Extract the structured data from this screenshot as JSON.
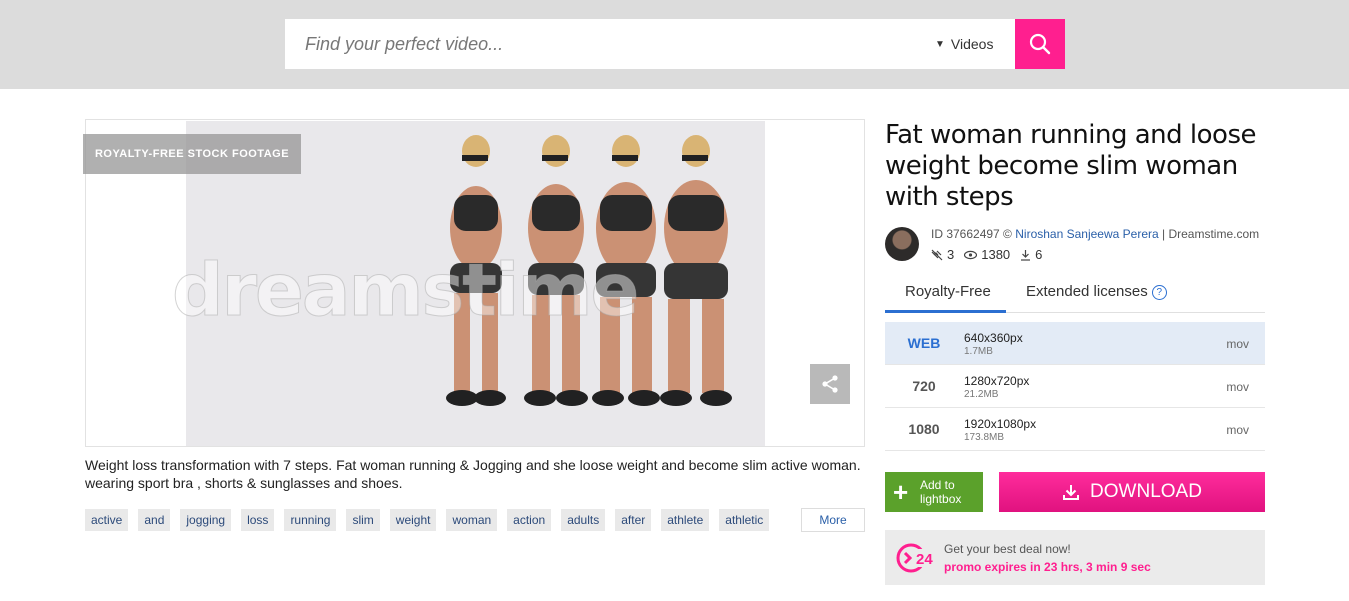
{
  "search": {
    "placeholder": "Find your perfect video...",
    "type_label": "Videos"
  },
  "media": {
    "badge": "ROYALTY-FREE STOCK FOOTAGE",
    "watermark": "dreamstime"
  },
  "description": "Weight loss transformation with 7 steps. Fat woman running & Jogging and she loose weight and become slim active woman. wearing sport bra , shorts & sunglasses and shoes.",
  "tags": [
    "active",
    "and",
    "jogging",
    "loss",
    "running",
    "slim",
    "weight",
    "woman",
    "action",
    "adults",
    "after",
    "athlete",
    "athletic"
  ],
  "more_label": "More",
  "title": "Fat woman running and loose weight become slim woman with steps",
  "meta": {
    "id_label": "ID 37662497 ©",
    "author": "Niroshan Sanjeewa Perera",
    "site": "| Dreamstime.com",
    "no_usage_count": "3",
    "views": "1380",
    "downloads": "6"
  },
  "tabs": {
    "royalty_free": "Royalty-Free",
    "extended": "Extended licenses",
    "help": "?"
  },
  "sizes": [
    {
      "label": "WEB",
      "dimensions": "640x360px",
      "filesize": "1.7MB",
      "format": "mov",
      "selected": true
    },
    {
      "label": "720",
      "dimensions": "1280x720px",
      "filesize": "21.2MB",
      "format": "mov",
      "selected": false
    },
    {
      "label": "1080",
      "dimensions": "1920x1080px",
      "filesize": "173.8MB",
      "format": "mov",
      "selected": false
    }
  ],
  "lightbox": {
    "plus": "+",
    "label": "Add to lightbox"
  },
  "download_label": "DOWNLOAD",
  "promo": {
    "icon_text": "24",
    "line1": "Get your best deal now!",
    "line2": "promo expires in 23 hrs, 3 min 9 sec"
  },
  "colors": {
    "accent_pink": "#ff1f8f",
    "accent_blue": "#2b6fd1",
    "lightbox_green": "#5ba12b"
  }
}
